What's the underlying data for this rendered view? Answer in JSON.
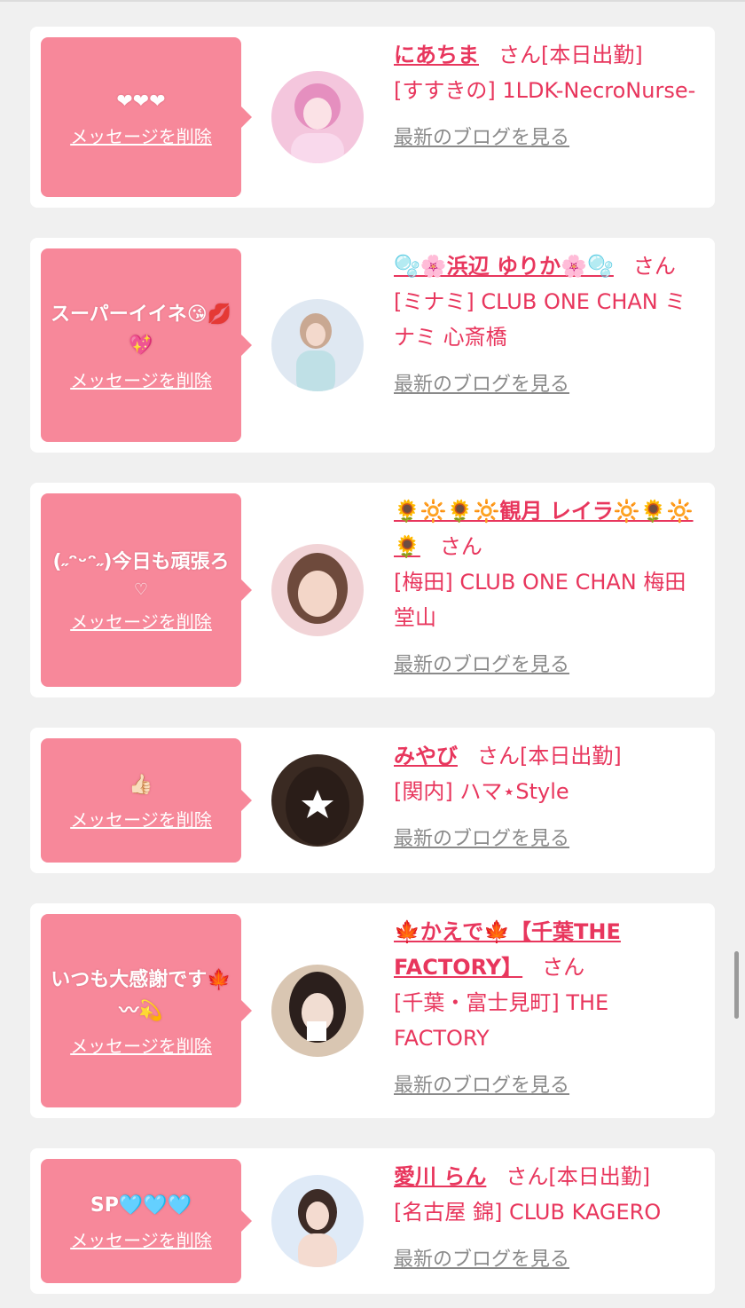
{
  "delete_label": "メッセージを削除",
  "blog_label": "最新のブログを見る",
  "san_label": "さん",
  "colors": {
    "accent": "#e8365d",
    "bubble": "#f7889a",
    "link_gray": "#8a8a8a"
  },
  "cards": [
    {
      "message": "❤❤❤",
      "message_sub": "",
      "name": "にあちま",
      "status": "[本日出勤]",
      "shop": "[すすきの] 1LDK-NecroNurse-"
    },
    {
      "message": "スーパーイイネ😘💋💖",
      "message_sub": "",
      "name": "🫧🌸浜辺 ゆりか🌸🫧",
      "status": "",
      "shop": "[ミナミ] CLUB ONE CHAN ミナミ 心斎橋"
    },
    {
      "message": "(˶ᵔᵕᵔ˶)今日も頑張ろ",
      "message_sub": "♡",
      "name": "🌻🔆🌻🔆観月 レイラ🔆🌻🔆🌻",
      "status": "",
      "shop": "[梅田] CLUB ONE CHAN 梅田堂山"
    },
    {
      "message": "👍🏻",
      "message_sub": "",
      "name": "みやび",
      "status": "[本日出勤]",
      "shop": "[関内] ハマ⋆Style"
    },
    {
      "message": "いつも大感謝です🍁〰💫",
      "message_sub": "",
      "name": "🍁かえで🍁【千葉THE FACTORY】",
      "status": "",
      "shop": "[千葉・富士見町] THE FACTORY"
    },
    {
      "message": "SP🩵🩵🩵",
      "message_sub": "",
      "name": "愛川 らん",
      "status": "[本日出勤]",
      "shop": "[名古屋 錦] CLUB KAGERO"
    }
  ]
}
